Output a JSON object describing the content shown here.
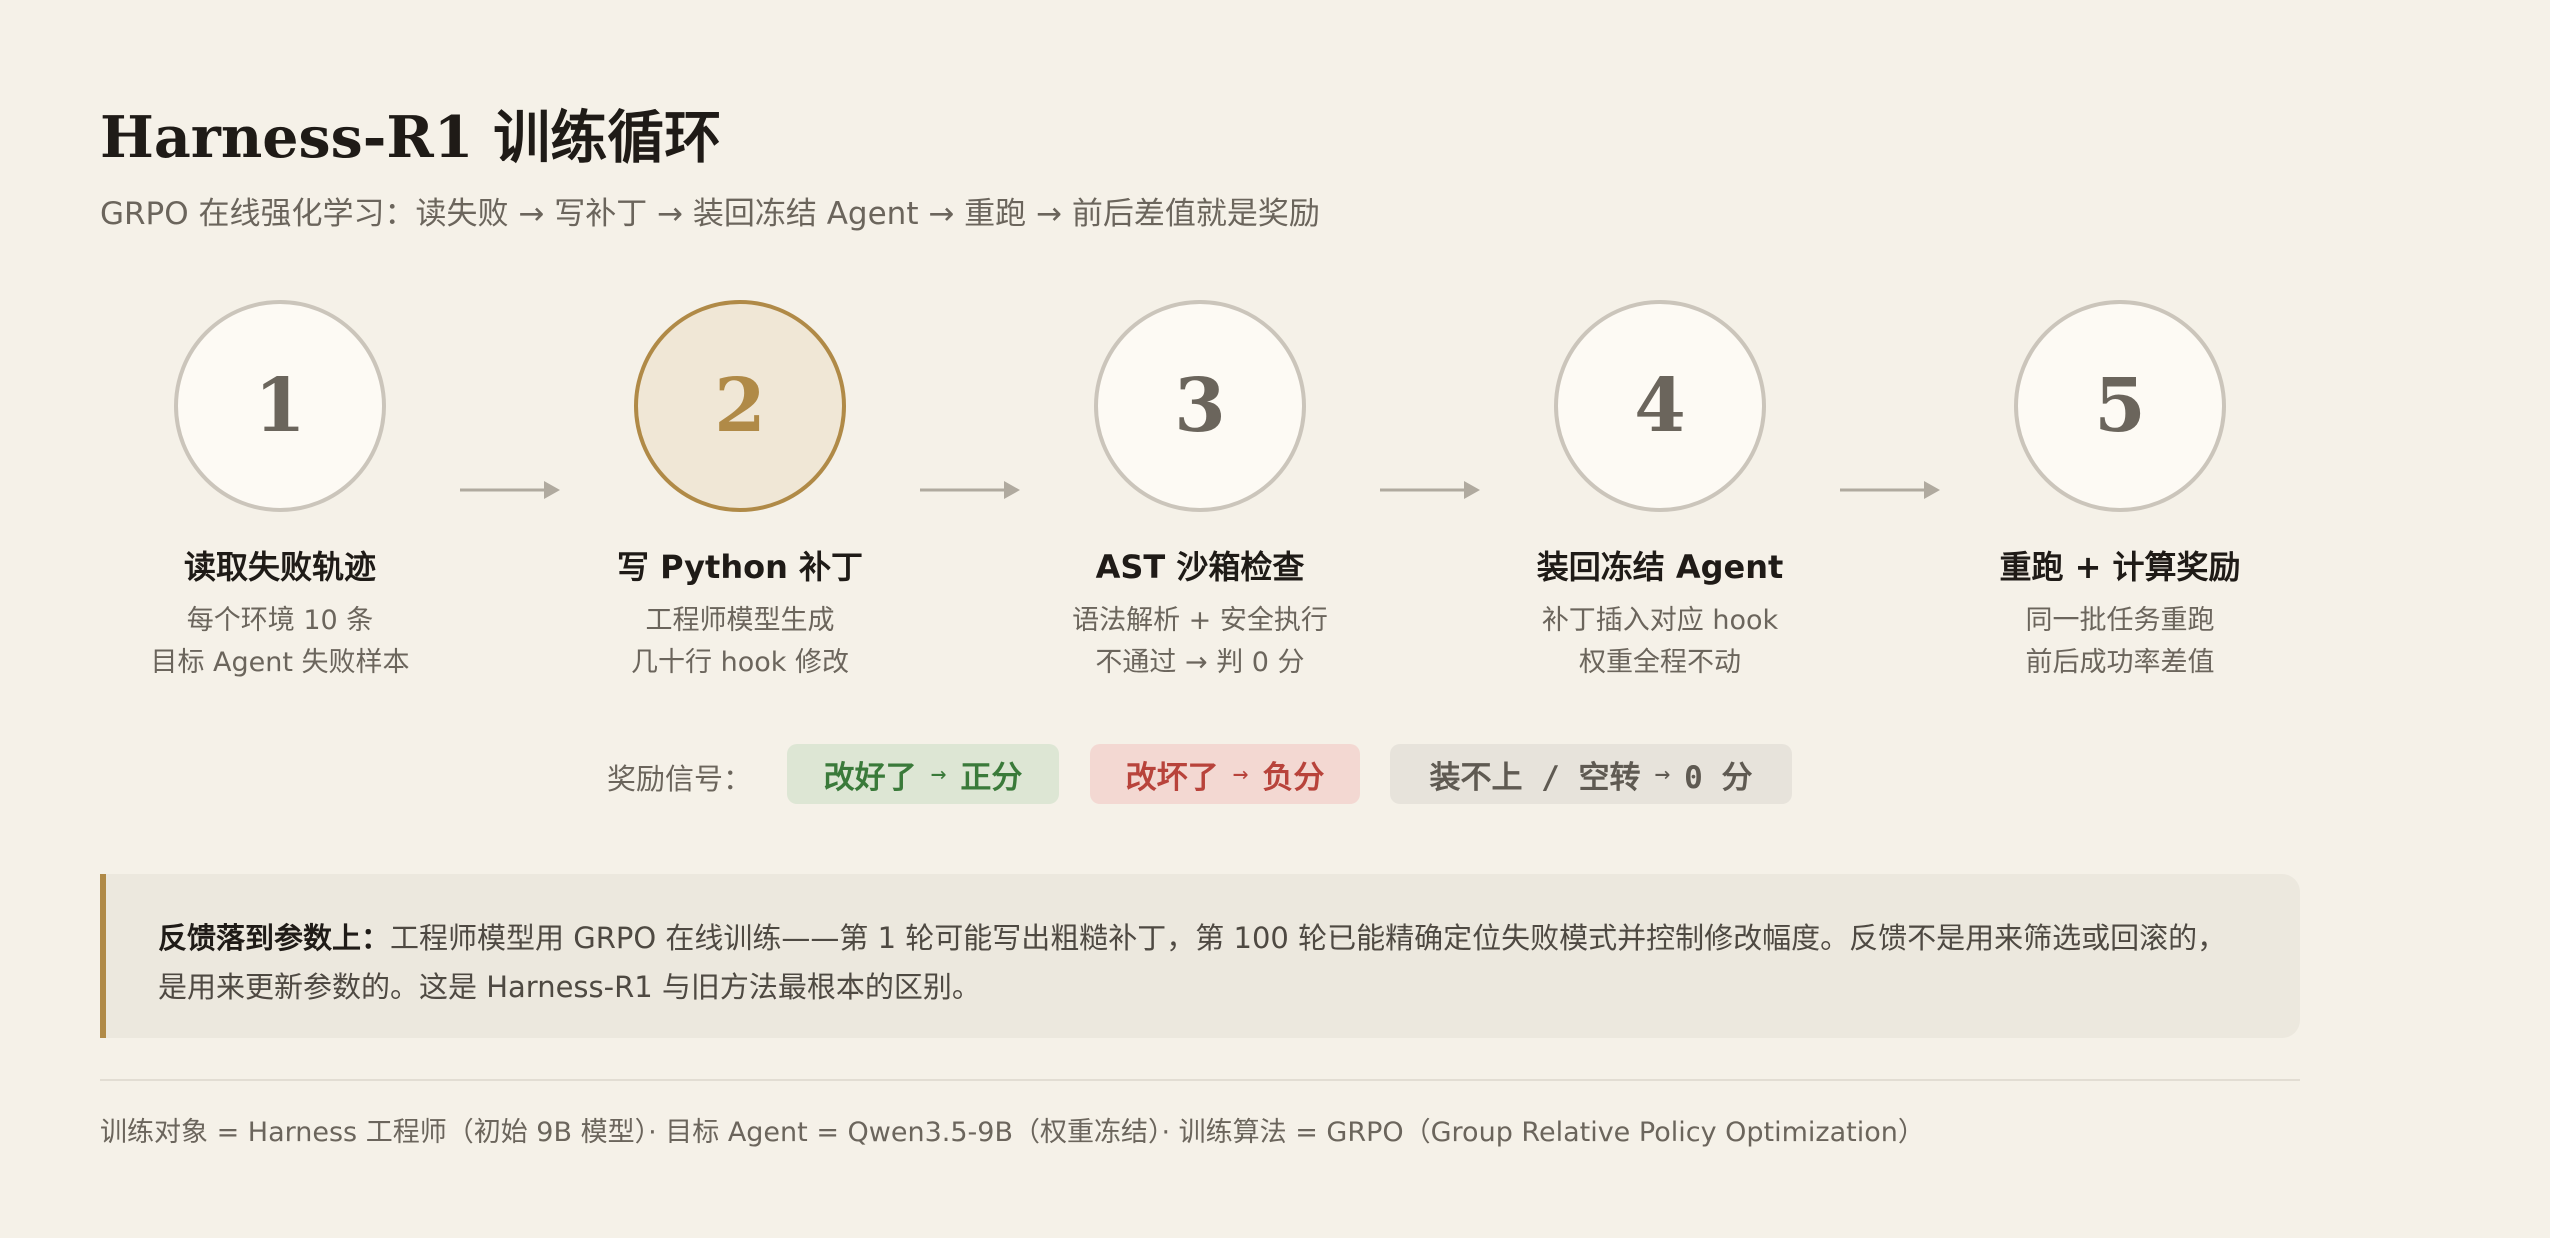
{
  "header": {
    "title": "Harness-R1 训练循环",
    "subtitle": "GRPO 在线强化学习：读失败 → 写补丁 → 装回冻结 Agent → 重跑 → 前后差值就是奖励"
  },
  "steps": [
    {
      "number": "1",
      "title": "读取失败轨迹",
      "line1": "每个环境 10 条",
      "line2": "目标 Agent 失败样本",
      "active": false
    },
    {
      "number": "2",
      "title": "写 Python 补丁",
      "line1": "工程师模型生成",
      "line2": "几十行 hook 修改",
      "active": true
    },
    {
      "number": "3",
      "title": "AST 沙箱检查",
      "line1": "语法解析 + 安全执行",
      "line2": "不通过 → 判 0 分",
      "active": false
    },
    {
      "number": "4",
      "title": "装回冻结 Agent",
      "line1": "补丁插入对应 hook",
      "line2": "权重全程不动",
      "active": false
    },
    {
      "number": "5",
      "title": "重跑 + 计算奖励",
      "line1": "同一批任务重跑",
      "line2": "前后成功率差值",
      "active": false
    }
  ],
  "reward": {
    "label": "奖励信号：",
    "good": {
      "left": "改好了",
      "arrow": "→",
      "right": "正分"
    },
    "bad": {
      "left": "改坏了",
      "arrow": "→",
      "right": "负分"
    },
    "zero": {
      "left": "装不上 / 空转",
      "arrow": "→",
      "right": "0 分"
    }
  },
  "note": {
    "lead": "反馈落到参数上：",
    "body": "工程师模型用 GRPO 在线训练——第 1 轮可能写出粗糙补丁，第 100 轮已能精确定位失败模式并控制修改幅度。反馈不是用来筛选或回滚的，是用来更新参数的。这是 Harness-R1 与旧方法最根本的区别。"
  },
  "footer": "训练对象 = Harness 工程师（初始 9B 模型）· 目标 Agent = Qwen3.5-9B（权重冻结）· 训练算法 = GRPO（Group Relative Policy Optimization）",
  "colors": {
    "background": "#f5f1e8",
    "accent": "#b08a47",
    "positive": "#3a7a3a",
    "negative": "#b8433b",
    "neutral": "#5f5a52"
  }
}
